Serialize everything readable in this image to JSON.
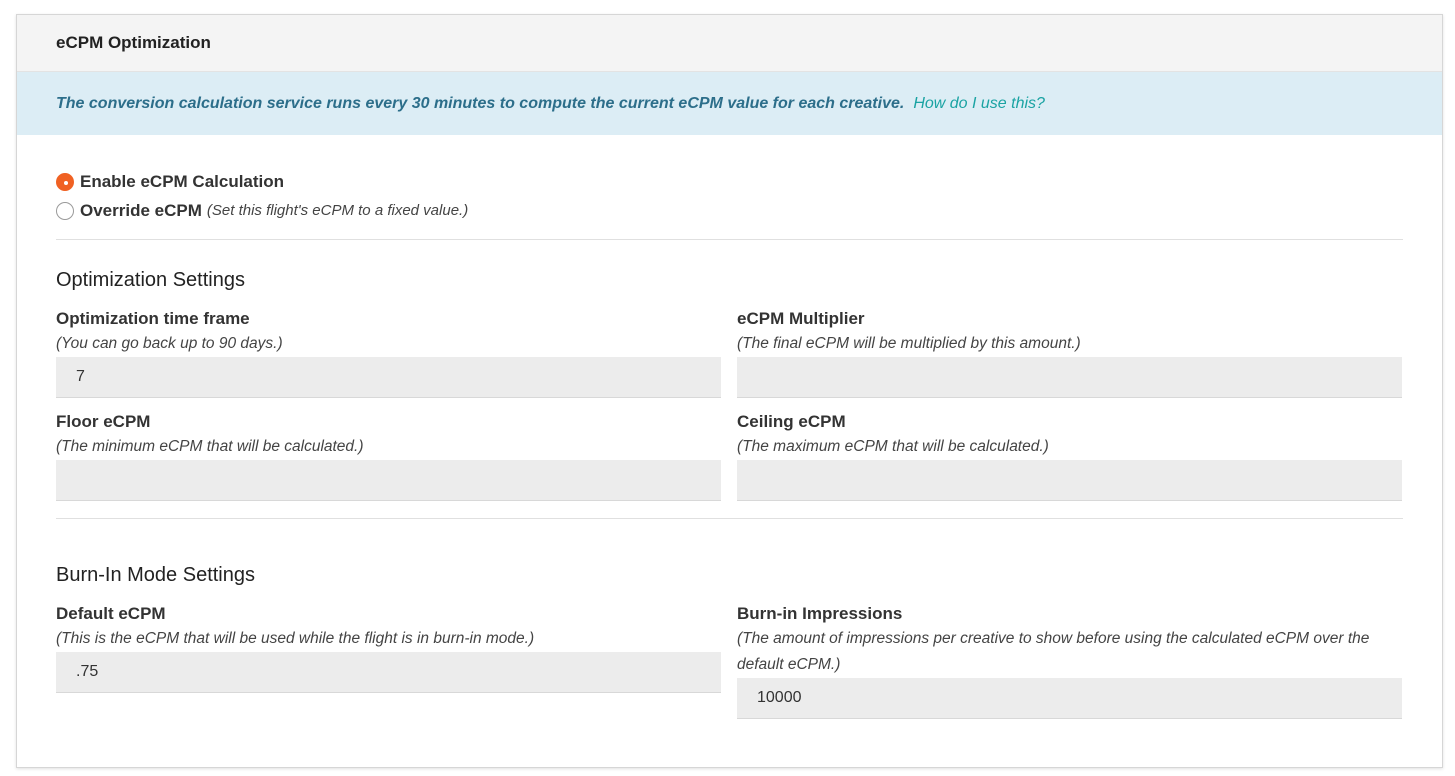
{
  "panel": {
    "title": "eCPM Optimization"
  },
  "info": {
    "text": "The conversion calculation service runs every 30 minutes to compute the current eCPM value for each creative.",
    "link": "How do I use this?"
  },
  "mode": {
    "selected": "enable",
    "options": [
      {
        "label": "Enable eCPM Calculation",
        "hint": ""
      },
      {
        "label": "Override eCPM",
        "hint": "(Set this flight's eCPM to a fixed value.)"
      }
    ]
  },
  "optimization": {
    "title": "Optimization Settings",
    "time_frame": {
      "label": "Optimization time frame",
      "hint": "(You can go back up to 90 days.)",
      "value": "7"
    },
    "multiplier": {
      "label": "eCPM Multiplier",
      "hint": "(The final eCPM will be multiplied by this amount.)",
      "value": ""
    },
    "floor": {
      "label": "Floor eCPM",
      "hint": "(The minimum eCPM that will be calculated.)",
      "value": ""
    },
    "ceiling": {
      "label": "Ceiling eCPM",
      "hint": "(The maximum eCPM that will be calculated.)",
      "value": ""
    }
  },
  "burnin": {
    "title": "Burn-In Mode Settings",
    "default_ecpm": {
      "label": "Default eCPM",
      "hint": "(This is the eCPM that will be used while the flight is in burn-in mode.)",
      "value": ".75"
    },
    "impressions": {
      "label": "Burn-in Impressions",
      "hint": "(The amount of impressions per creative to show before using the calculated eCPM over the default eCPM.)",
      "value": "10000"
    }
  }
}
